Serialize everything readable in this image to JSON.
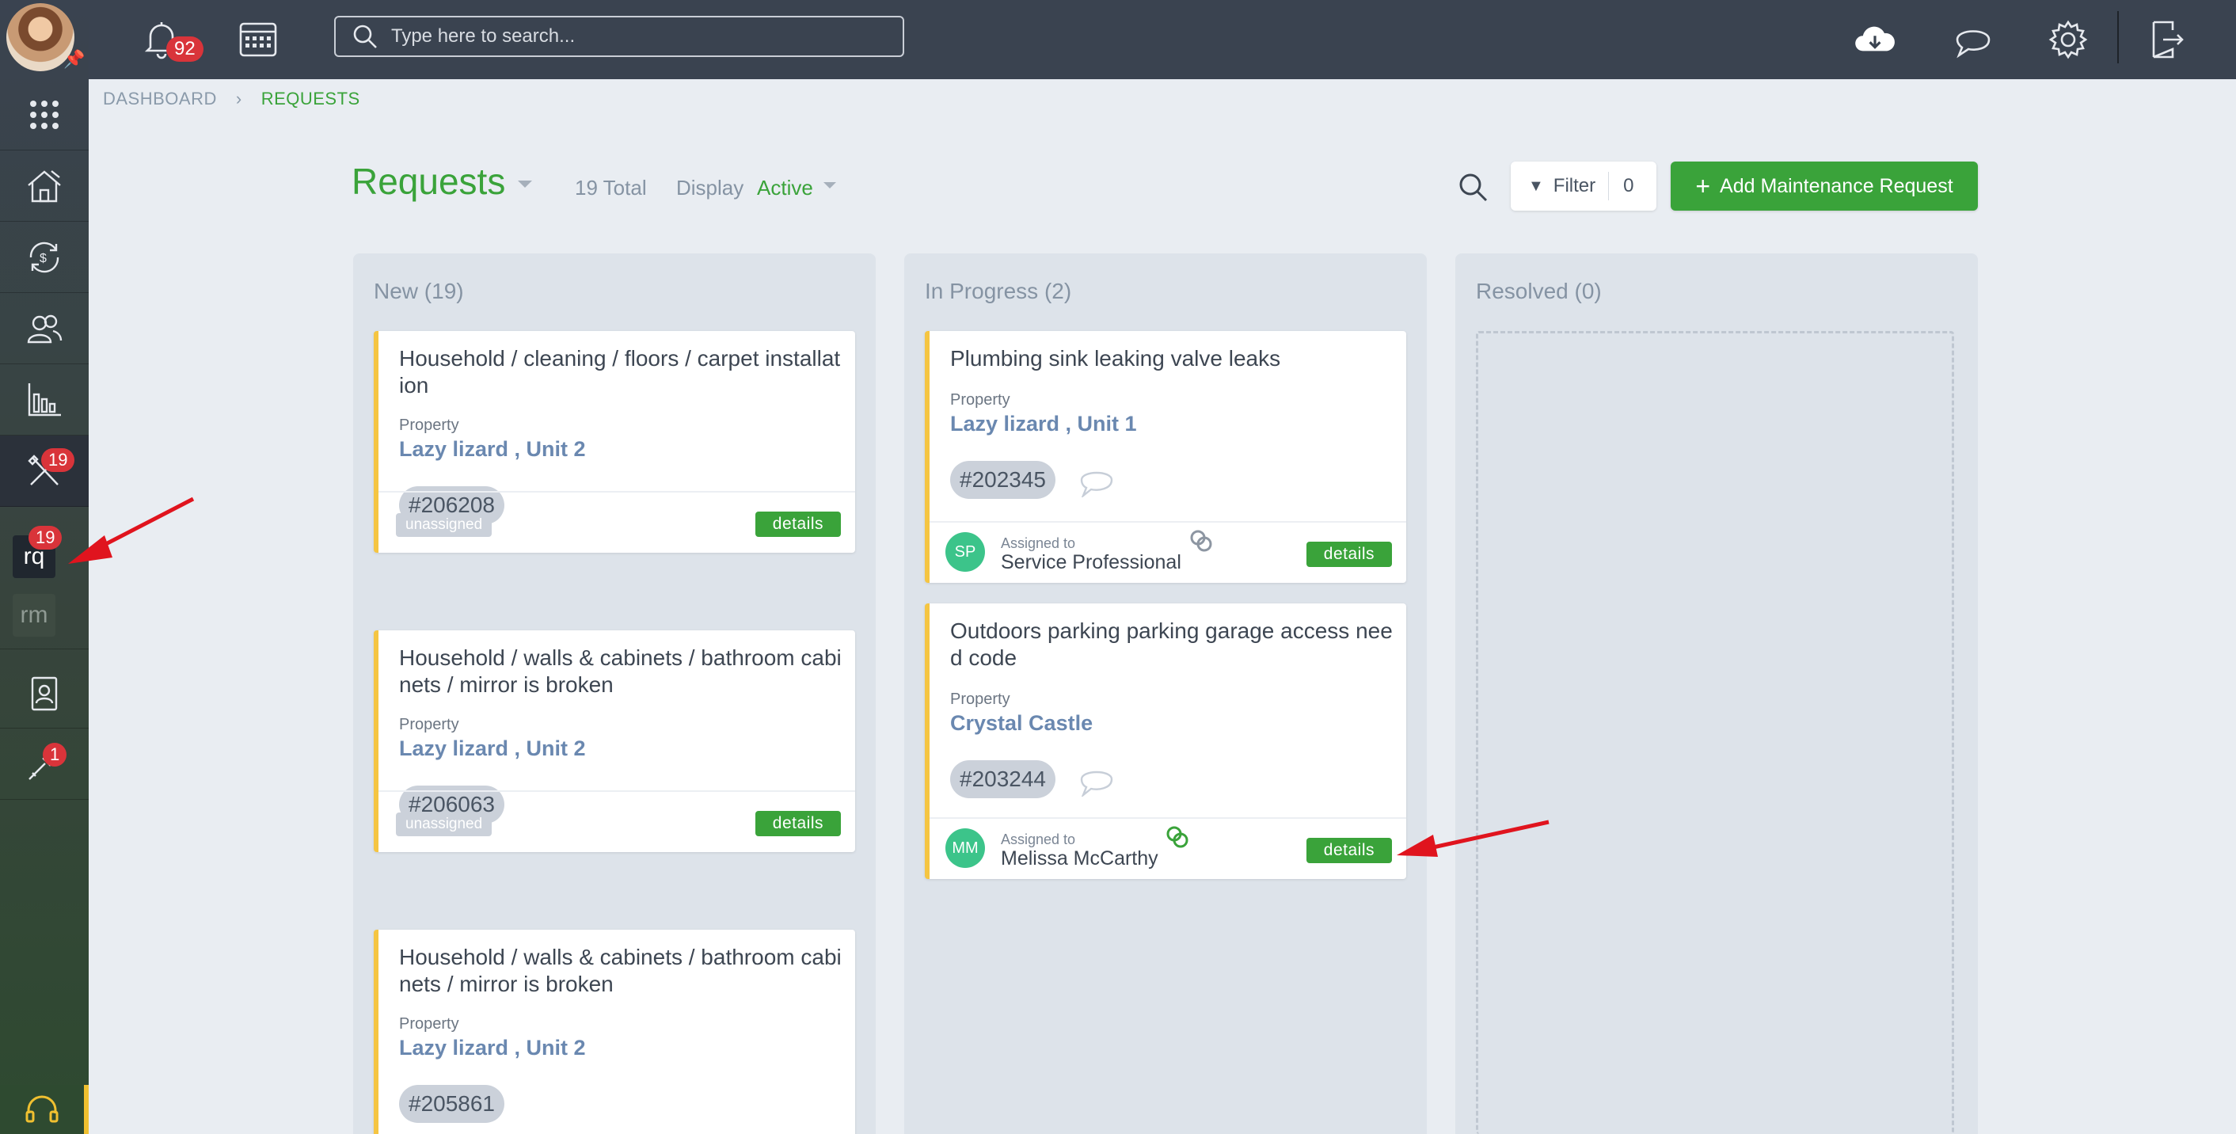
{
  "sidebar": {
    "badges": {
      "maintenance": "19",
      "requests": "19",
      "tools": "1"
    },
    "sub_items": {
      "requests": "rq",
      "rooms": "rm"
    }
  },
  "topbar": {
    "notification_count": "92",
    "search_placeholder": "Type here to search..."
  },
  "breadcrumb": {
    "root": "DASHBOARD",
    "current": "REQUESTS"
  },
  "header": {
    "title": "Requests",
    "total": "19 Total",
    "display_label": "Display",
    "display_value": "Active",
    "filter_label": "Filter",
    "filter_count": "0",
    "add_button": "Add Maintenance Request"
  },
  "columns": [
    {
      "title": "New (19)",
      "cards": [
        {
          "title": "Household / cleaning / floors / carpet installation",
          "property_label": "Property",
          "property": "Lazy lizard , Unit 2",
          "id": "#206208",
          "status": "unassigned",
          "action": "details"
        },
        {
          "title": "Household / walls & cabinets / bathroom cabinets / mirror is broken",
          "property_label": "Property",
          "property": "Lazy lizard , Unit 2",
          "id": "#206063",
          "status": "unassigned",
          "action": "details"
        },
        {
          "title": "Household / walls & cabinets / bathroom cabinets / mirror is broken",
          "property_label": "Property",
          "property": "Lazy lizard , Unit 2",
          "id": "#205861"
        }
      ]
    },
    {
      "title": "In Progress (2)",
      "cards": [
        {
          "title": "Plumbing sink leaking valve leaks",
          "property_label": "Property",
          "property": "Lazy lizard , Unit 1",
          "id": "#202345",
          "assigned_label": "Assigned to",
          "assignee_initials": "SP",
          "assignee": "Service Professional",
          "action": "details"
        },
        {
          "title": "Outdoors parking parking garage access need code",
          "property_label": "Property",
          "property": "Crystal Castle",
          "id": "#203244",
          "assigned_label": "Assigned to",
          "assignee_initials": "MM",
          "assignee": "Melissa McCarthy",
          "action": "details"
        }
      ]
    },
    {
      "title": "Resolved (0)",
      "cards": []
    }
  ],
  "colors": {
    "accent": "#3aa33a",
    "topbar": "#3a4350",
    "card_border": "#f5c542",
    "badge": "#d9343a",
    "annotation_arrow": "#e0141e"
  }
}
